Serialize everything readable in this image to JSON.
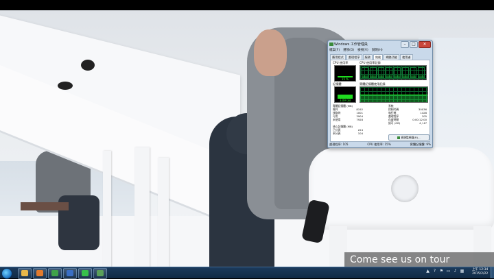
{
  "window": {
    "title": "Windows 工作管理員",
    "controls": {
      "minimize": "–",
      "maximize": "□",
      "close": "✕"
    },
    "menu": [
      "檔案(F)",
      "選項(O)",
      "檢視(V)",
      "說明(H)"
    ],
    "tabs": [
      "應用程式",
      "處理程序",
      "服務",
      "效能",
      "網路功能",
      "使用者"
    ],
    "active_tab": "效能"
  },
  "performance": {
    "cpu_usage_label": "CPU 使用率",
    "cpu_usage_value": "15 %",
    "cpu_usage_fraction": 0.15,
    "cpu_history_label": "CPU 使用率記錄",
    "memory_label": "記憶體",
    "memory_value": "3.09 GB",
    "memory_fraction": 0.45,
    "memory_history_label": "實體記憶體使用記錄",
    "physical_memory": {
      "header": "實體記憶體 (MB)",
      "rows": [
        {
          "label": "總共",
          "value": "8192"
        },
        {
          "label": "快取的",
          "value": "1001"
        },
        {
          "label": "可用",
          "value": "3904"
        },
        {
          "label": "未使用",
          "value": "7928"
        }
      ]
    },
    "system": {
      "header": "系統",
      "rows": [
        {
          "label": "控制代碼",
          "value": "30036"
        },
        {
          "label": "執行緒",
          "value": "1428"
        },
        {
          "label": "處理程序",
          "value": "105"
        },
        {
          "label": "存留時間",
          "value": "0:00:12:00"
        },
        {
          "label": "認可 (GB)",
          "value": "4 / 47"
        }
      ]
    },
    "kernel_memory": {
      "header": "核心記憶體 (MB)",
      "rows": [
        {
          "label": "已分頁",
          "value": "224"
        },
        {
          "label": "未分頁",
          "value": "104"
        }
      ]
    },
    "resource_monitor_button": "資源監視器(R)..."
  },
  "status_bar": {
    "processes": "處理程序: 105",
    "cpu": "CPU 使用率: 15%",
    "memory": "實體記憶體: 9%"
  },
  "subtitle": "Come see us on tour",
  "taskbar": {
    "pinned": [
      {
        "name": "explorer",
        "color": "#e9b84a"
      },
      {
        "name": "media-player",
        "color": "#e37b2d"
      },
      {
        "name": "chrome",
        "color": "#3fa24a"
      },
      {
        "name": "app-blue",
        "color": "#3a6fc4"
      },
      {
        "name": "line",
        "color": "#36c04b"
      },
      {
        "name": "task-manager",
        "color": "#5aa05a"
      }
    ],
    "clock_time": "上午 12:34",
    "clock_date": "2015/2/22"
  }
}
